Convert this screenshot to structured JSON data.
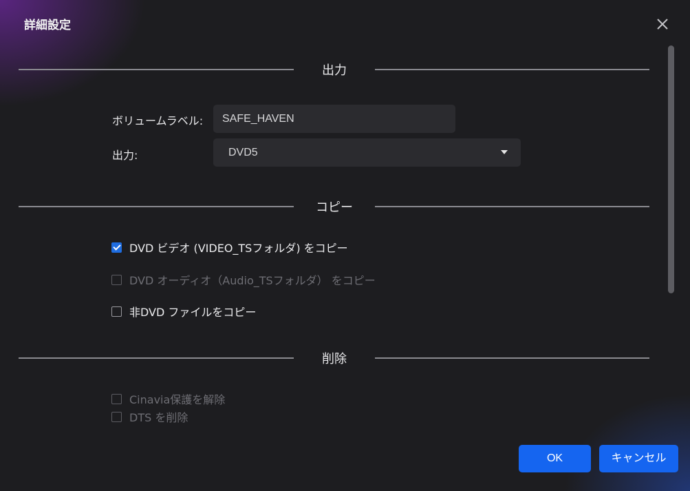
{
  "dialog": {
    "title": "詳細設定"
  },
  "sections": {
    "output": {
      "title": "出力",
      "volume_label": {
        "label": "ボリュームラベル:",
        "value": "SAFE_HAVEN"
      },
      "output": {
        "label": "出力:",
        "selected": "DVD5"
      }
    },
    "copy": {
      "title": "コピー",
      "options": [
        {
          "label": "DVD ビデオ (VIDEO_TSフォルダ) をコピー",
          "checked": true,
          "enabled": true
        },
        {
          "label": "DVD オーディオ（Audio_TSフォルダ） をコピー",
          "checked": false,
          "enabled": false
        },
        {
          "label": "非DVD ファイルをコピー",
          "checked": false,
          "enabled": true
        }
      ]
    },
    "remove": {
      "title": "削除",
      "options": [
        {
          "label": "Cinavia保護を解除",
          "checked": false,
          "enabled": false
        },
        {
          "label": "DTS を削除",
          "checked": false,
          "enabled": false
        }
      ]
    }
  },
  "buttons": {
    "ok": "OK",
    "cancel": "キャンセル"
  },
  "colors": {
    "accent": "#1565f0",
    "background": "#1d1d20",
    "checkbox_checked": "#1f6de0"
  }
}
